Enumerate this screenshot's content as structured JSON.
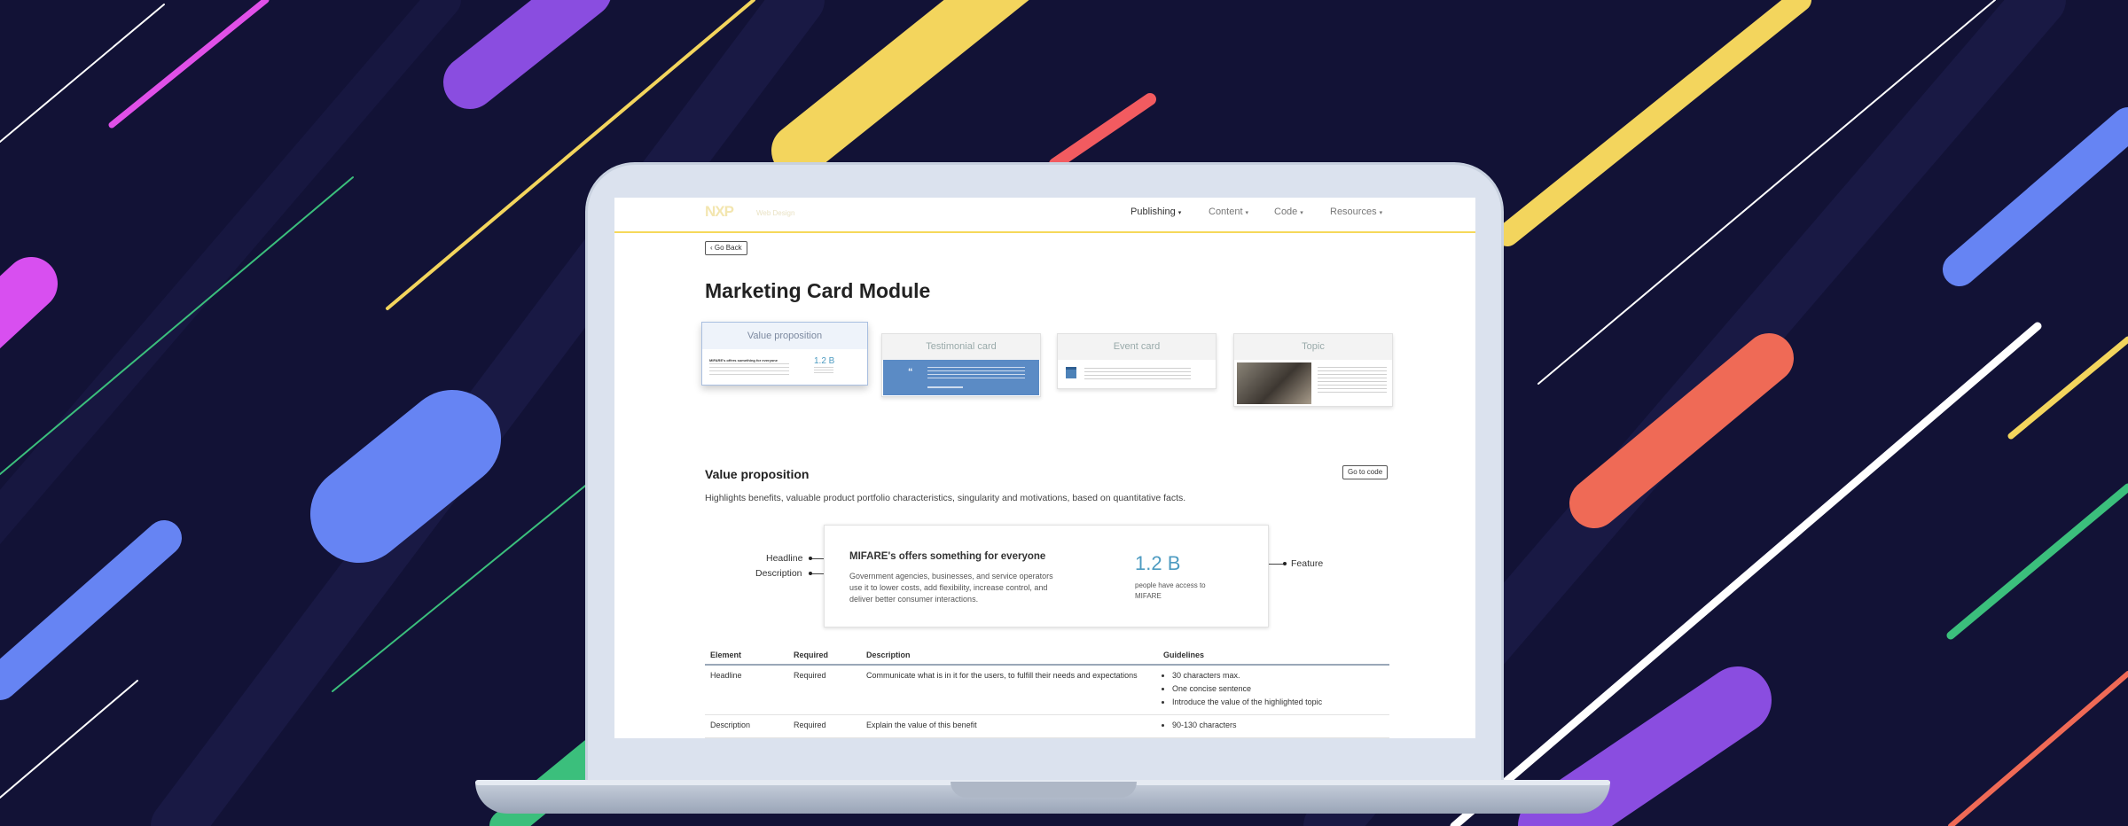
{
  "colors": {
    "background": "#121236",
    "accent_yellow": "#f6d95a",
    "feature_blue": "#4d9bc1",
    "testimonial_blue": "#5b8bc5"
  },
  "app": {
    "logo": "NXP",
    "logo_sub": "Web Design"
  },
  "nav": {
    "items": [
      {
        "label": "Publishing",
        "icon": "chevron-down-icon"
      },
      {
        "label": "Content",
        "icon": "chevron-down-icon"
      },
      {
        "label": "Code",
        "icon": "chevron-down-icon"
      },
      {
        "label": "Resources",
        "icon": "chevron-down-icon"
      }
    ]
  },
  "page": {
    "back_label": "‹ Go Back",
    "title": "Marketing Card Module",
    "cards": [
      {
        "label": "Value proposition",
        "selected": true
      },
      {
        "label": "Testimonial card",
        "selected": false
      },
      {
        "label": "Event card",
        "selected": false
      },
      {
        "label": "Topic",
        "selected": false
      }
    ],
    "mini_value": {
      "headline": "MIFARE's offers something for everyone",
      "number": "1.2 B"
    },
    "mini_testimonial": {
      "quote_mark": "“"
    }
  },
  "section": {
    "title": "Value proposition",
    "code_button": "Go to code",
    "description": "Highlights benefits, valuable product portfolio characteristics, singularity and motivations, based on quantitative facts."
  },
  "example": {
    "headline": "MIFARE's offers something for everyone",
    "description": "Government agencies, businesses, and service operators use it to lower costs, add flexibility, increase control, and deliver better consumer interactions.",
    "feature_number": "1.2 B",
    "feature_caption": "people have access to MIFARE",
    "annotations": {
      "headline": "Headline",
      "description": "Description",
      "feature": "Feature"
    }
  },
  "table": {
    "headers": [
      "Element",
      "Required",
      "Description",
      "Guidelines"
    ],
    "rows": [
      {
        "element": "Headline",
        "required": "Required",
        "description": "Communicate what is in it for the users, to fulfill their needs and expectations",
        "guidelines": [
          "30 characters max.",
          "One concise sentence",
          "Introduce the value of the highlighted topic"
        ]
      },
      {
        "element": "Description",
        "required": "Required",
        "description": "Explain the value of this benefit",
        "guidelines": [
          "90-130 characters"
        ]
      }
    ]
  }
}
